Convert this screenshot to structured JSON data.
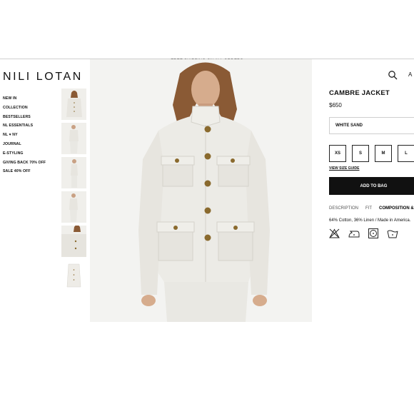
{
  "promo": "FREE SHIPPING ON ALL ORDERS",
  "brand": {
    "logo_text": "NILI LOTAN"
  },
  "nav": {
    "items": [
      "NEW IN",
      "COLLECTION",
      "BESTSELLERS",
      "NL ESSENTIALS",
      "NL ♥ NY",
      "JOURNAL",
      "E-STYLING",
      "GIVING BACK 70% OFF",
      "SALE 40% OFF"
    ]
  },
  "header": {
    "account_text": "A",
    "search_icon": "search-icon"
  },
  "product": {
    "title": "CAMBRE JACKET",
    "price": "$650",
    "color_selected": "WHITE SAND",
    "sizes": [
      "XS",
      "S",
      "M",
      "L"
    ],
    "size_guide": "VIEW SIZE GUIDE",
    "add_to_bag": "ADD TO BAG",
    "tabs": [
      "DESCRIPTION",
      "FIT",
      "COMPOSITION &"
    ],
    "active_tab": "COMPOSITION &",
    "composition": "64% Cotton, 36% Linen / Made in America.",
    "care_icons": [
      "no-bleach-icon",
      "iron-icon",
      "tumble-dry-icon",
      "wash-icon"
    ]
  },
  "colors": {
    "accent": "#111111",
    "jacket": "#ecebe6",
    "hair": "#8a5a35",
    "button": "#8a6a2e"
  }
}
